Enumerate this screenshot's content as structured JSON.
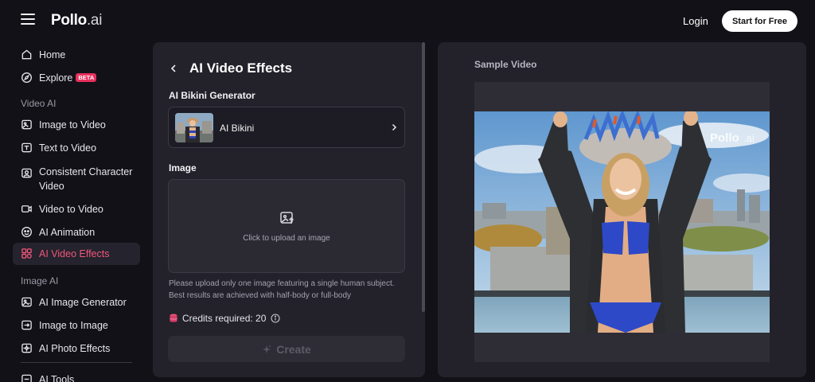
{
  "header": {
    "logo_main": "Pollo",
    "logo_suffix": ".ai",
    "login_label": "Login",
    "start_label": "Start for Free"
  },
  "sidebar": {
    "home": "Home",
    "explore": "Explore",
    "explore_badge": "BETA",
    "section_video": "Video AI",
    "video_items": [
      "Image to Video",
      "Text to Video",
      "Consistent Character Video",
      "Video to Video",
      "AI Animation",
      "AI Video Effects"
    ],
    "section_image": "Image AI",
    "image_items": [
      "AI Image Generator",
      "Image to Image",
      "AI Photo Effects"
    ],
    "tools": "AI Tools"
  },
  "panel": {
    "title": "AI Video Effects",
    "generator_label": "AI Bikini Generator",
    "effect_name": "AI Bikini",
    "image_label": "Image",
    "upload_text": "Click to upload an image",
    "hint_line1": "Please upload only one image featuring a single human subject.",
    "hint_line2": "Best results are achieved with half-body or full-body",
    "credits_label": "Credits required: 20",
    "create_label": "Create"
  },
  "preview": {
    "label": "Sample Video",
    "watermark_main": "Pollo",
    "watermark_suffix": ".ai"
  },
  "colors": {
    "accent": "#f0567a",
    "background": "#121117",
    "panel": "#23222b"
  }
}
